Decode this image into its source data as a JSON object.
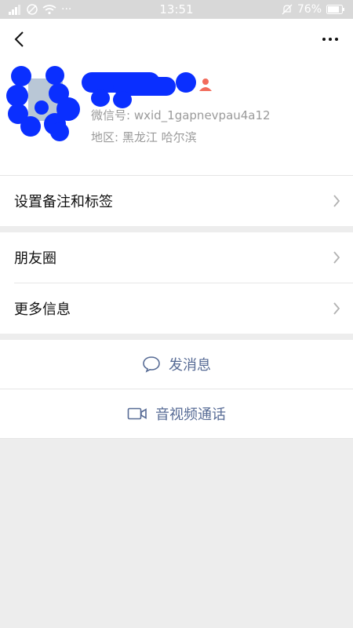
{
  "status_bar": {
    "time": "13:51",
    "battery": "76%",
    "dots": "···"
  },
  "profile": {
    "wechat_id": "微信号: wxid_1gapnevpau4a12",
    "region": "地区: 黑龙江  哈尔滨"
  },
  "menu": {
    "remarks_tags": "设置备注和标签",
    "moments": "朋友圈",
    "more_info": "更多信息"
  },
  "actions": {
    "message": "发消息",
    "video_call": "音视频通话"
  },
  "colors": {
    "link": "#576b95",
    "redaction": "#0a2fff",
    "gender_icon": "#f26b5b"
  }
}
